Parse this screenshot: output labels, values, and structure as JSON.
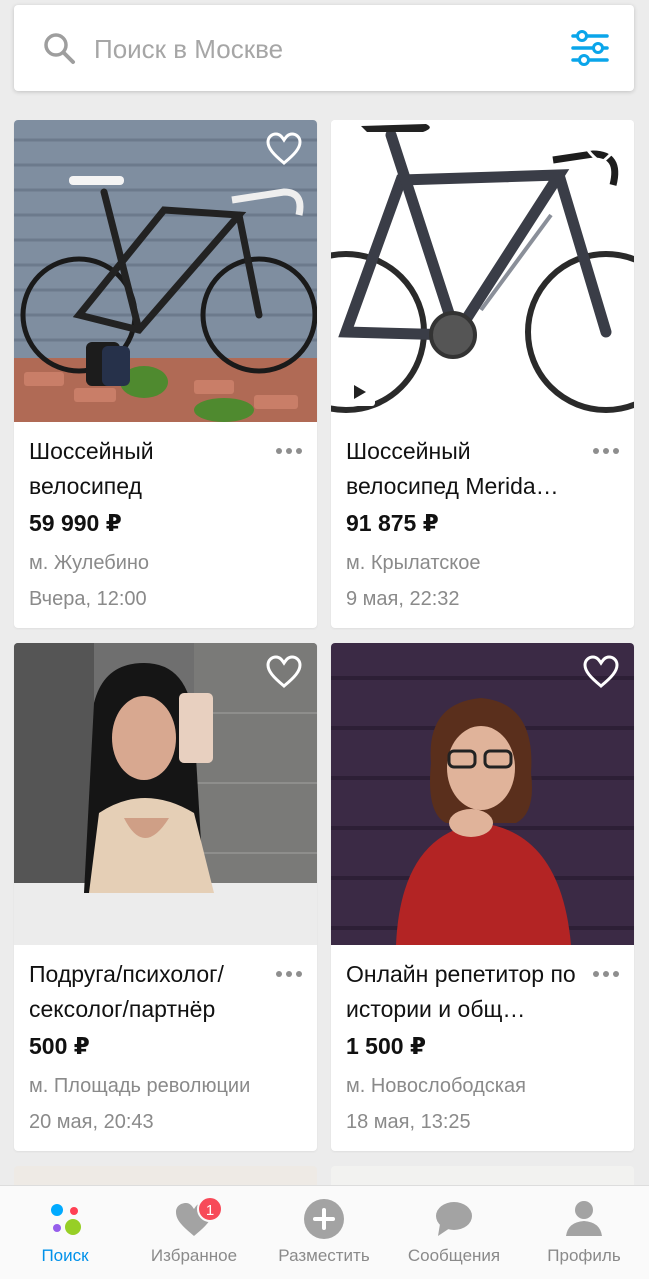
{
  "search": {
    "placeholder": "Поиск в Москве"
  },
  "listings": [
    {
      "title": "Шоссейный велосипед",
      "price": "59 990 ₽",
      "location": "м. Жулебино",
      "date": "Вчера, 12:00",
      "image": "black-road-bike-pepino"
    },
    {
      "title": "Шоссейный велосипед Merida…",
      "price": "91 875 ₽",
      "location": "м. Крылатское",
      "date": "9 мая, 22:32",
      "image": "grey-road-bike-merida",
      "has_video": true
    },
    {
      "title": "Подруга/психолог/ сексолог/партнёр",
      "price": "500 ₽",
      "location": "м. Площадь революции",
      "date": "20 мая, 20:43",
      "image": "woman-selfie-mirror"
    },
    {
      "title": "Онлайн репетитор по истории и общ…",
      "price": "1 500 ₽",
      "location": "м. Новослободская",
      "date": "18 мая, 13:25",
      "image": "woman-glasses-red-top"
    }
  ],
  "nav": {
    "items": [
      {
        "label": "Поиск",
        "icon": "search-dots-icon",
        "active": true
      },
      {
        "label": "Избранное",
        "icon": "heart-icon",
        "badge": "1"
      },
      {
        "label": "Разместить",
        "icon": "plus-icon"
      },
      {
        "label": "Сообщения",
        "icon": "chat-icon"
      },
      {
        "label": "Профиль",
        "icon": "profile-icon"
      }
    ]
  },
  "colors": {
    "accent": "#0091ea",
    "badge": "#f74a59",
    "background": "#ececec"
  }
}
